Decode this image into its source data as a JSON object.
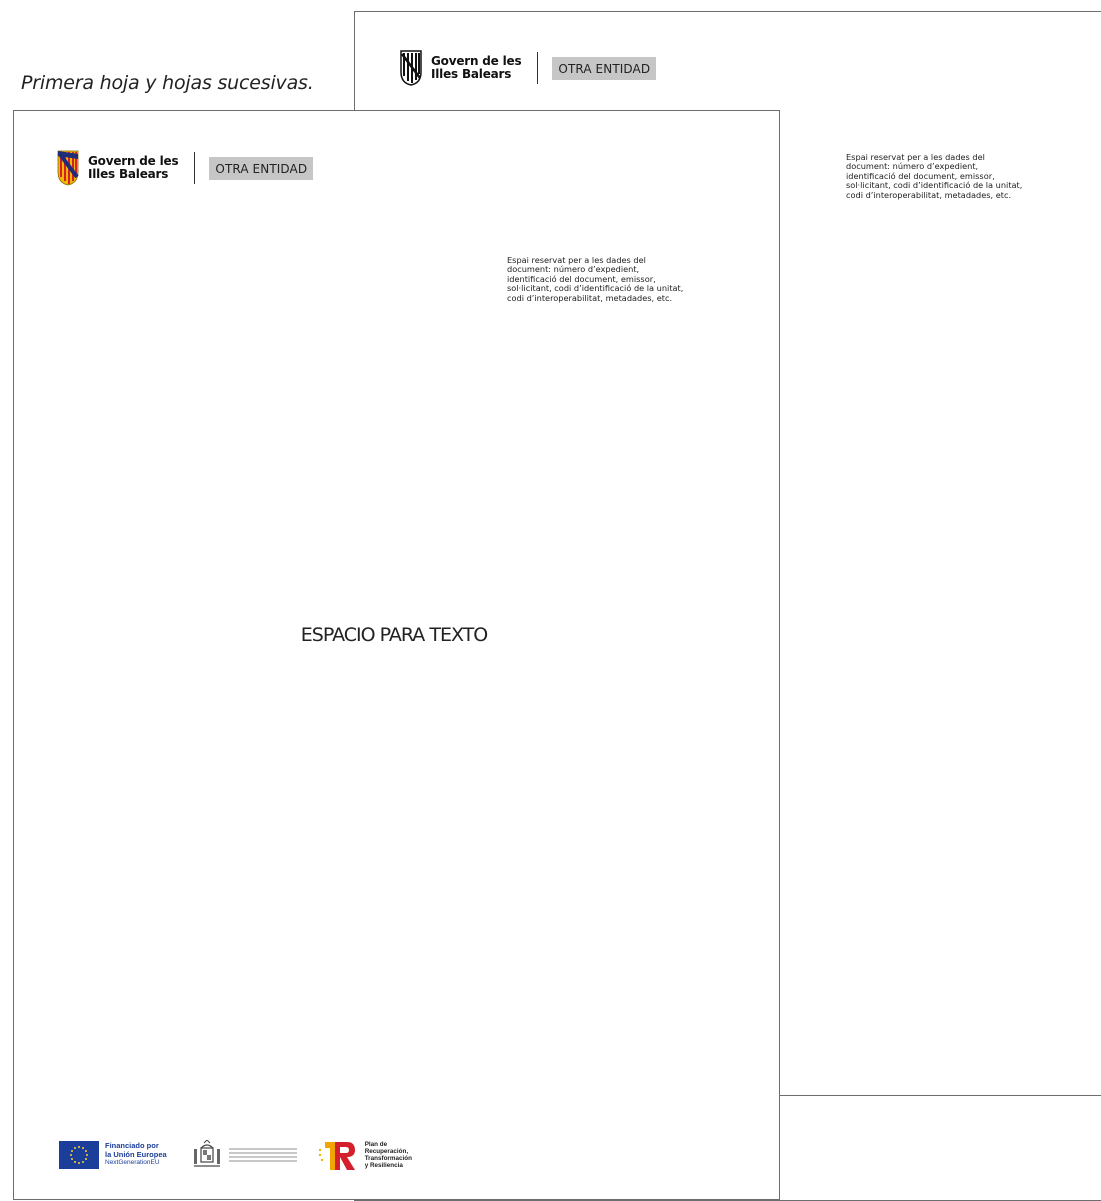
{
  "caption": "Primera hoja y hojas sucesivas.",
  "header": {
    "gov_line1": "Govern de les",
    "gov_line2": "Illes Balears",
    "entity": "OTRA ENTIDAD"
  },
  "reserved_text": "Espai reservat per a les dades del\ndocument: número d’expedient,\nidentificació del document, emissor,\nsol·licitant, codi d’identificació de la unitat,\ncodi d’interoperabilitat, metadades, etc.",
  "body_text": "ESPACIO PARA TEXTO",
  "footer": {
    "eu_line1": "Financiado por",
    "eu_line2": "la Unión Europea",
    "eu_line3": "NextGenerationEU",
    "prtr_line1": "Plan de",
    "prtr_line2": "Recuperación,",
    "prtr_line3": "Transformación",
    "prtr_line4": "y Resiliencia"
  },
  "colors": {
    "crest_red": "#d4202c",
    "crest_yellow": "#f2b705",
    "crest_blue": "#1f2c7a",
    "eu_blue": "#1a3e9a",
    "eu_star": "#f8d52a",
    "entity_bg": "#c6c6c6"
  }
}
